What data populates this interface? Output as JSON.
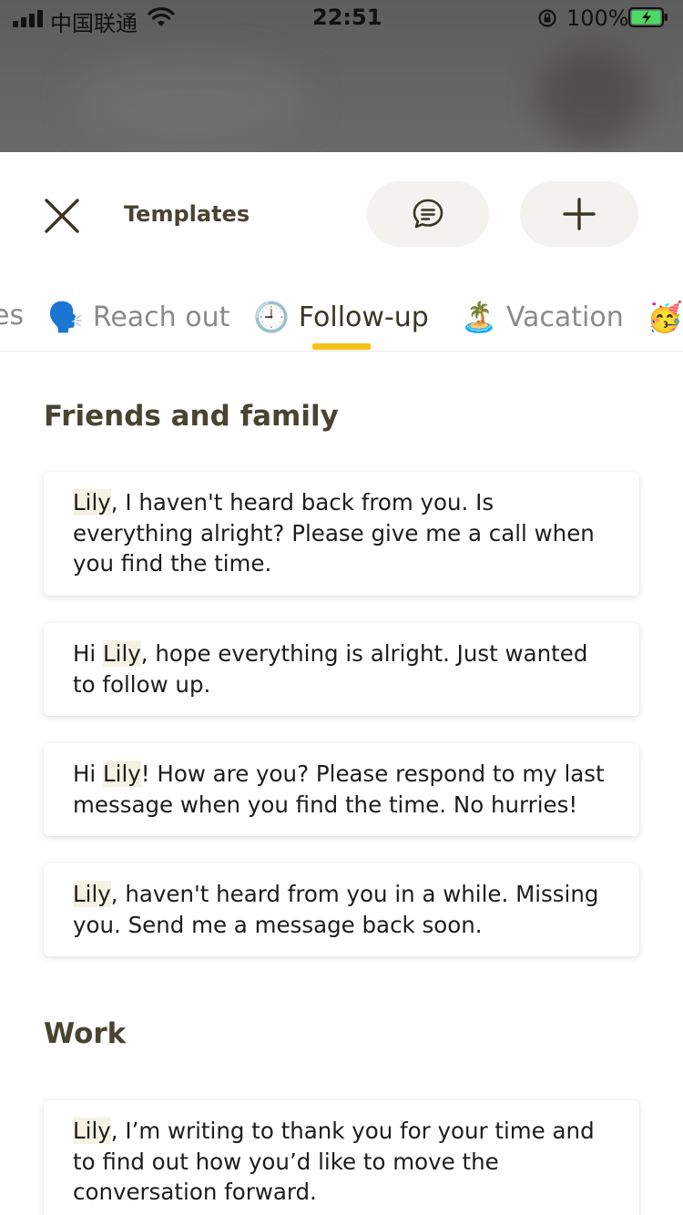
{
  "status": {
    "carrier": "中国联通",
    "time": "22:51",
    "battery": "100%"
  },
  "header": {
    "title": "Templates",
    "close_icon": "close-icon",
    "chat_icon": "chat-bubble-icon",
    "add_icon": "plus-icon"
  },
  "tabs": [
    {
      "emoji": "",
      "label": "es"
    },
    {
      "emoji": "🗣️",
      "label": "Reach out"
    },
    {
      "emoji": "🕘",
      "label": "Follow-up"
    },
    {
      "emoji": "🏝️",
      "label": "Vacation"
    },
    {
      "emoji": "🥳",
      "label": ""
    }
  ],
  "active_tab": "Follow-up",
  "accent_color": "#f7c21a",
  "sections": [
    {
      "title": "Friends and family",
      "templates": [
        {
          "pre": "",
          "name": "Lily",
          "post": ", I haven't heard back from you. Is everything alright? Please give me a call when you find the time."
        },
        {
          "pre": "Hi ",
          "name": "Lily",
          "post": ", hope everything is alright. Just wanted to follow up."
        },
        {
          "pre": "Hi ",
          "name": "Lily",
          "post": "! How are you? Please respond to my last message when you find the time. No hurries!"
        },
        {
          "pre": "",
          "name": "Lily",
          "post": ", haven't heard from you in a while. Missing you. Send me a message back soon."
        }
      ]
    },
    {
      "title": "Work",
      "templates": [
        {
          "pre": "",
          "name": "Lily",
          "post": ", I’m writing to thank you for your time and to find out how you’d like to move the conversation forward."
        }
      ]
    }
  ]
}
